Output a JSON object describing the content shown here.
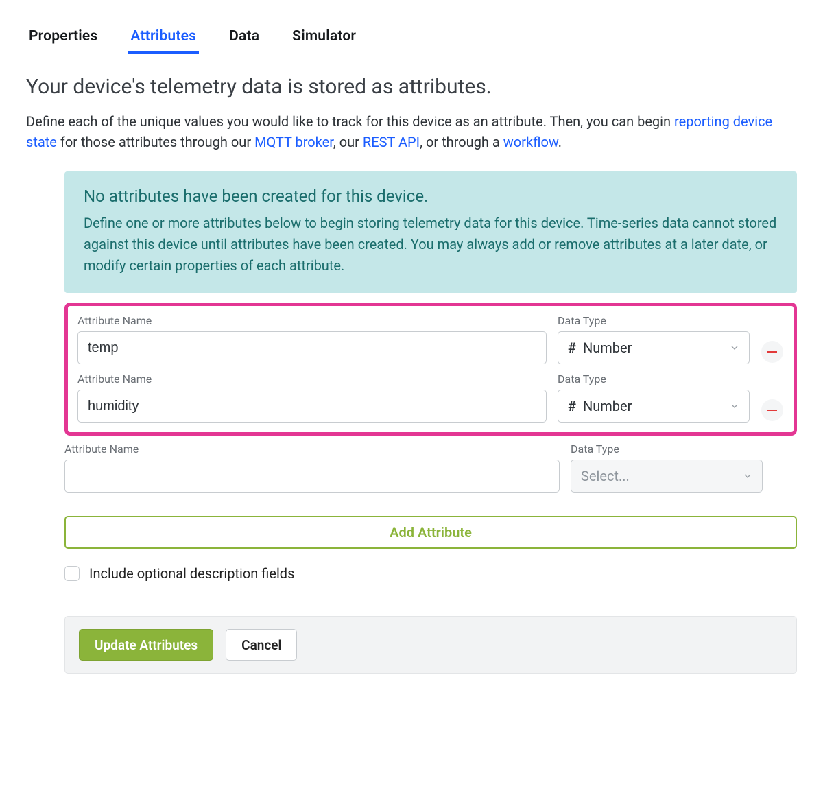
{
  "tabs": {
    "properties": "Properties",
    "attributes": "Attributes",
    "data": "Data",
    "simulator": "Simulator"
  },
  "heading": "Your device's telemetry data is stored as attributes.",
  "intro": {
    "part1": "Define each of the unique values you would like to track for this device as an attribute. Then, you can begin ",
    "link1": "reporting device state",
    "part2": " for those attributes through our ",
    "link2": "MQTT broker",
    "part3": ", our ",
    "link3": "REST API",
    "part4": ", or through a ",
    "link4": "workflow",
    "part5": "."
  },
  "info": {
    "title": "No attributes have been created for this device.",
    "body": "Define one or more attributes below to begin storing telemetry data for this device. Time-series data cannot stored against this device until attributes have been created. You may always add or remove attributes at a later date, or modify certain properties of each attribute."
  },
  "labels": {
    "attribute_name": "Attribute Name",
    "data_type": "Data Type"
  },
  "rows": [
    {
      "name": "temp",
      "type_icon": "#",
      "type_label": "Number"
    },
    {
      "name": "humidity",
      "type_icon": "#",
      "type_label": "Number"
    }
  ],
  "blank_row": {
    "name": "",
    "type_placeholder": "Select..."
  },
  "add_attribute_label": "Add Attribute",
  "include_desc_label": "Include optional description fields",
  "footer": {
    "update": "Update Attributes",
    "cancel": "Cancel"
  }
}
